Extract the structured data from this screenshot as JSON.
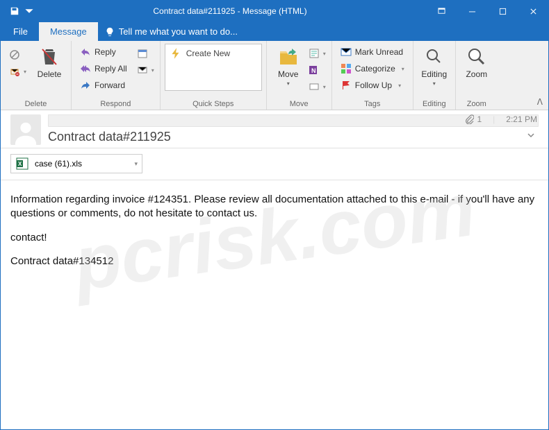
{
  "titlebar": {
    "title": "Contract data#211925 - Message (HTML)"
  },
  "tabs": {
    "file": "File",
    "message": "Message",
    "tell_me": "Tell me what you want to do..."
  },
  "ribbon": {
    "delete": {
      "label": "Delete",
      "group": "Delete"
    },
    "respond": {
      "reply": "Reply",
      "reply_all": "Reply All",
      "forward": "Forward",
      "group": "Respond"
    },
    "quicksteps": {
      "create_new": "Create New",
      "group": "Quick Steps"
    },
    "move": {
      "label": "Move",
      "group": "Move"
    },
    "tags": {
      "mark_unread": "Mark Unread",
      "categorize": "Categorize",
      "follow_up": "Follow Up",
      "group": "Tags"
    },
    "editing": {
      "label": "Editing",
      "group": "Editing"
    },
    "zoom": {
      "label": "Zoom",
      "group": "Zoom"
    }
  },
  "header": {
    "subject": "Contract data#211925",
    "attachment_count": "1",
    "time": "2:21 PM"
  },
  "attachment": {
    "name": "case (61).xls"
  },
  "body": {
    "p1": "Information regarding invoice #124351. Please review all documentation attached to this e-mail - if you'll have any questions or comments, do not hesitate to contact us.",
    "p2": "contact!",
    "p3": "Contract data#134512"
  },
  "watermark": "pcrisk.com"
}
